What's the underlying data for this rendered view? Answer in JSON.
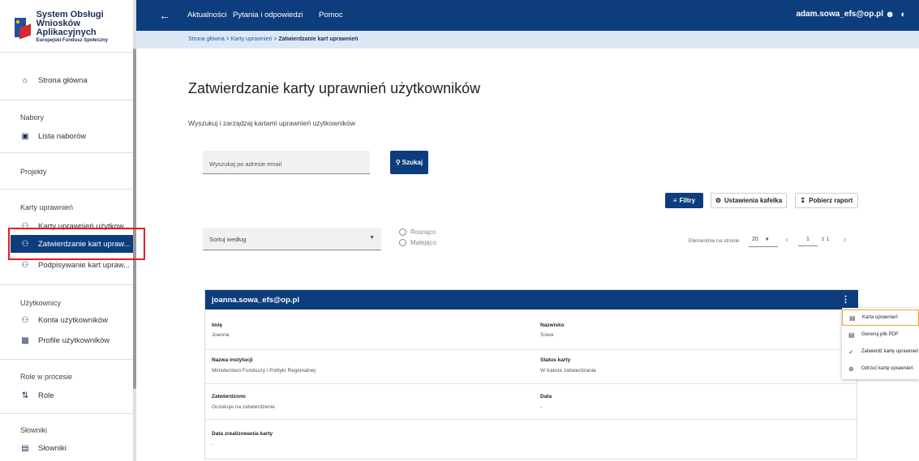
{
  "sidebar": {
    "logo": {
      "line1": "System Obsługi",
      "line2": "Wniosków Aplikacyjnych",
      "line3": "Europejski Fundusz Społeczny"
    },
    "home": {
      "label": "Strona główna",
      "icon": "home-icon"
    },
    "sections": {
      "nabory": {
        "title": "Nabory",
        "items": [
          {
            "label": "Lista naborów",
            "icon": "archive-icon"
          }
        ]
      },
      "projekty": {
        "title": "Projekty"
      },
      "karty": {
        "title": "Karty uprawnień",
        "items": [
          {
            "label": "Karty uprawnień użytkow...",
            "icon": "people-icon"
          },
          {
            "label": "Zatwierdzanie kart upraw...",
            "icon": "people-icon"
          },
          {
            "label": "Podpisywanie kart upraw...",
            "icon": "people-icon"
          }
        ]
      },
      "uzytkownicy": {
        "title": "Użytkownicy",
        "items": [
          {
            "label": "Konta użytkowników",
            "icon": "people-icon"
          },
          {
            "label": "Profile użytkowników",
            "icon": "profile-card-icon"
          }
        ]
      },
      "role": {
        "title": "Role w procesie",
        "items": [
          {
            "label": "Role",
            "icon": "roles-icon"
          }
        ]
      },
      "slowniki": {
        "title": "Słowniki",
        "items": [
          {
            "label": "Słowniki",
            "icon": "dictionary-icon"
          }
        ]
      }
    }
  },
  "topbar": {
    "nav": [
      "Aktualności",
      "Pytania i odpowiedzi",
      "Pomoc"
    ],
    "user": "adam.sowa_efs@op.pl"
  },
  "breadcrumb": {
    "home": "Strona główna",
    "sep": ">",
    "parent": "Karty uprawnień",
    "current": "Zatwierdzanie kart uprawnień"
  },
  "main": {
    "title": "Zatwierdzanie karty uprawnień użytkowników",
    "subtitle": "Wyszukuj i zarządzaj kartami uprawnień użytkowników",
    "search_placeholder": "Wyszukaj po adresie email",
    "search_button": "Szukaj",
    "filters_button": "Filtry",
    "tile_settings_button": "Ustawienia kafelka",
    "report_button": "Pobierz raport",
    "sort_label": "Sortuj według",
    "sort_asc": "Rosnąco",
    "sort_desc": "Malejąco",
    "pager": {
      "label": "Elementów na stronie",
      "size": "20",
      "page": "1",
      "of": "z 1"
    }
  },
  "card": {
    "email": "joanna.sowa_efs@op.pl",
    "fields": {
      "imie": {
        "label": "Imię",
        "value": "Joanna"
      },
      "nazwisko": {
        "label": "Nazwisko",
        "value": "Sowa"
      },
      "instytucja": {
        "label": "Nazwa instytucji",
        "value": "Ministerstwo Funduszy i Polityki Regionalnej"
      },
      "status": {
        "label": "Status karty",
        "value": "W trakcie zatwierdzania"
      },
      "zatwierdzono": {
        "label": "Zatwierdzono",
        "value": "Oczekuje na zatwierdzenie"
      },
      "data": {
        "label": "Data",
        "value": "-"
      },
      "data_zreal": {
        "label": "Data zrealizowania karty",
        "value": "-"
      }
    }
  },
  "menu": {
    "items": [
      {
        "label": "Karta uprawnień",
        "icon": "document-icon"
      },
      {
        "label": "Generuj plik PDF",
        "icon": "document-icon"
      },
      {
        "label": "Zatwierdź kartę uprawnień",
        "icon": "check-circle-icon"
      },
      {
        "label": "Odrzuć kartę uprawnień",
        "icon": "cancel-circle-icon"
      }
    ]
  }
}
